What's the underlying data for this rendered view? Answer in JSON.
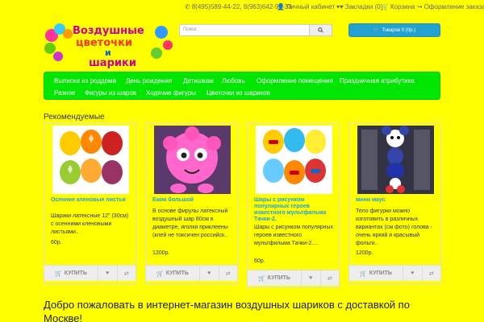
{
  "topbar": {
    "phones": "8(495)589-44-22, 8(963)642-99-33",
    "account": "Личный кабинет",
    "bookmarks": "Закладки (0)",
    "cart": "Корзина",
    "checkout": "Оформление заказа"
  },
  "logo": {
    "line1": "Воздушные",
    "line2": "цветочки",
    "line3": "и",
    "line4": "шарики"
  },
  "search": {
    "placeholder": "Поиск"
  },
  "cart_button": {
    "label": "Товаров 0 (0р.)"
  },
  "menu": {
    "items": [
      "Выписка из роддома",
      "День рождения",
      "Детишкам",
      "Любовь",
      "Оформление помещения",
      "Праздничная атрибутика",
      "Разное",
      "Фигуры из шаров",
      "Ходячие фигуры",
      "Цветочки из шариков"
    ]
  },
  "recommended": {
    "title": "Рекомендуемые",
    "products": [
      {
        "name": "Осенние кленовые листья",
        "description": "Шарики латексные 12\" (30см) с осенними кленовыми листьями..",
        "price": "60р."
      },
      {
        "name": "Ежик большой",
        "description": "В основе фирулы латексный воздушный шар 80см в диаметре, иголки приклеены (клей не токсичен российск..",
        "price": "1200р."
      },
      {
        "name": "Шары с рисунком популярных героев известного мультфильма Тачки-2.",
        "description": "Шары с рисунком популярных героев известного мультфильма Тачки-2....",
        "price": "60р."
      },
      {
        "name": "мини маус",
        "description": "Тело фигурки можно изготовить в различных вариантах (см фото) голова - очень яркий и красывый фольги..",
        "price": "1200р."
      }
    ],
    "buy_label": "КУПИТЬ"
  },
  "welcome": "Добро пожаловать в интернет-магазин воздушных шариков с доставкой по Москве!"
}
